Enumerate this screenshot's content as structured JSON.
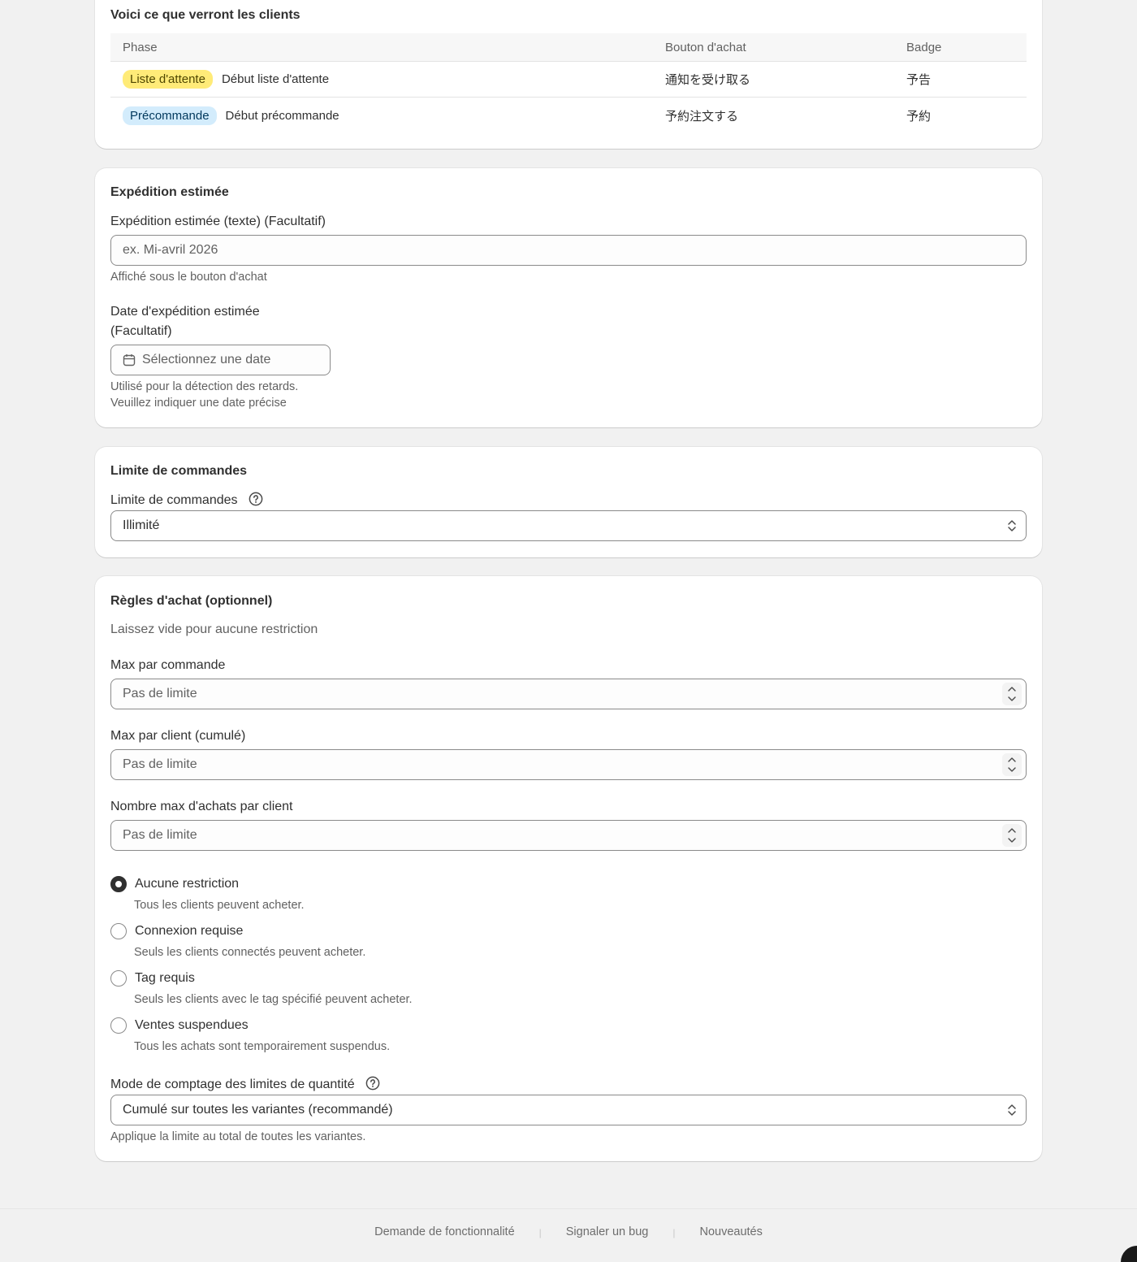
{
  "preview": {
    "title": "Voici ce que verront les clients",
    "headers": {
      "phase": "Phase",
      "button": "Bouton d'achat",
      "badge": "Badge"
    },
    "rows": [
      {
        "pill": "Liste d'attente",
        "pill_color": "#ffeb78",
        "phase": "Début liste d'attente",
        "button": "通知を受け取る",
        "badge": "予告"
      },
      {
        "pill": "Précommande",
        "pill_color": "#d3ecfc",
        "phase": "Début précommande",
        "button": "予約注文する",
        "badge": "予約"
      }
    ]
  },
  "shipping": {
    "title": "Expédition estimée",
    "text_label": "Expédition estimée (texte) (Facultatif)",
    "text_placeholder": "ex. Mi-avril 2026",
    "text_help": "Affiché sous le bouton d'achat",
    "date_label_line1": "Date d'expédition estimée",
    "date_label_line2": "(Facultatif)",
    "date_placeholder": "Sélectionnez une date",
    "date_help_line1": "Utilisé pour la détection des retards.",
    "date_help_line2": "Veuillez indiquer une date précise"
  },
  "limit": {
    "title": "Limite de commandes",
    "label": "Limite de commandes",
    "value": "Illimité"
  },
  "rules": {
    "title": "Règles d'achat (optionnel)",
    "subtitle": "Laissez vide pour aucune restriction",
    "max_order_label": "Max par commande",
    "max_order_placeholder": "Pas de limite",
    "max_client_label": "Max par client (cumulé)",
    "max_client_placeholder": "Pas de limite",
    "max_purchases_label": "Nombre max d'achats par client",
    "max_purchases_placeholder": "Pas de limite",
    "options": [
      {
        "label": "Aucune restriction",
        "help": "Tous les clients peuvent acheter.",
        "checked": true
      },
      {
        "label": "Connexion requise",
        "help": "Seuls les clients connectés peuvent acheter.",
        "checked": false
      },
      {
        "label": "Tag requis",
        "help": "Seuls les clients avec le tag spécifié peuvent acheter.",
        "checked": false
      },
      {
        "label": "Ventes suspendues",
        "help": "Tous les achats sont temporairement suspendus.",
        "checked": false
      }
    ],
    "mode_label": "Mode de comptage des limites de quantité",
    "mode_value": "Cumulé sur toutes les variantes (recommandé)",
    "mode_help": "Applique la limite au total de toutes les variantes."
  },
  "footer": {
    "links": [
      "Demande de fonctionnalité",
      "Signaler un bug",
      "Nouveautés"
    ],
    "separator": "|"
  }
}
